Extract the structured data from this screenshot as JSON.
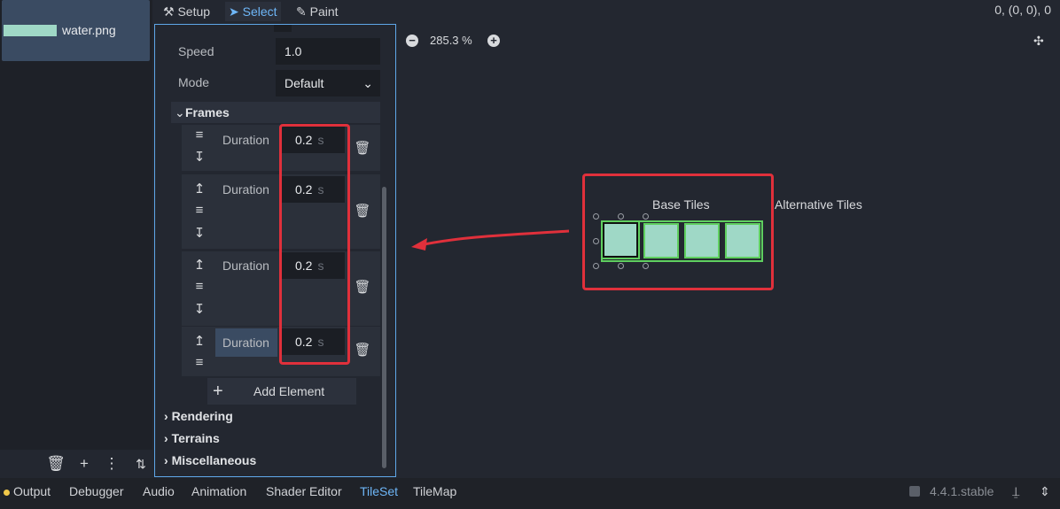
{
  "source_panel": {
    "file_name": "water.png",
    "toolbar_icons": [
      "trash-icon",
      "plus-icon",
      "more-vertical-icon",
      "sort-icon"
    ]
  },
  "top_bar": {
    "tabs": [
      {
        "label": "Setup",
        "icon": "setup-icon"
      },
      {
        "label": "Select",
        "icon": "cursor-icon"
      },
      {
        "label": "Paint",
        "icon": "paint-icon"
      }
    ],
    "active_tab": "Select",
    "coords": "0, (0, 0), 0"
  },
  "inspector": {
    "speed_label": "Speed",
    "speed_value": "1.0",
    "mode_label": "Mode",
    "mode_value": "Default",
    "frames_label": "Frames",
    "frames": [
      {
        "label": "Duration",
        "value": "0.2",
        "unit": "s"
      },
      {
        "label": "Duration",
        "value": "0.2",
        "unit": "s"
      },
      {
        "label": "Duration",
        "value": "0.2",
        "unit": "s"
      },
      {
        "label": "Duration",
        "value": "0.2",
        "unit": "s"
      }
    ],
    "add_element": "Add Element",
    "sections": [
      "Rendering",
      "Terrains",
      "Miscellaneous"
    ]
  },
  "canvas": {
    "zoom": "285.3 %",
    "base_tiles_label": "Base Tiles",
    "alternative_tiles_label": "Alternative Tiles",
    "tile_count": 4
  },
  "bottom_bar": {
    "tabs": [
      "Output",
      "Debugger",
      "Audio",
      "Animation",
      "Shader Editor",
      "TileSet",
      "TileMap"
    ],
    "active_tab": "TileSet",
    "version": "4.4.1.stable"
  },
  "colors": {
    "accent": "#6eb6f7",
    "annotation_red": "#e0303b",
    "tile_fill": "#9fd8c6",
    "tile_border": "#5fcf5f"
  }
}
